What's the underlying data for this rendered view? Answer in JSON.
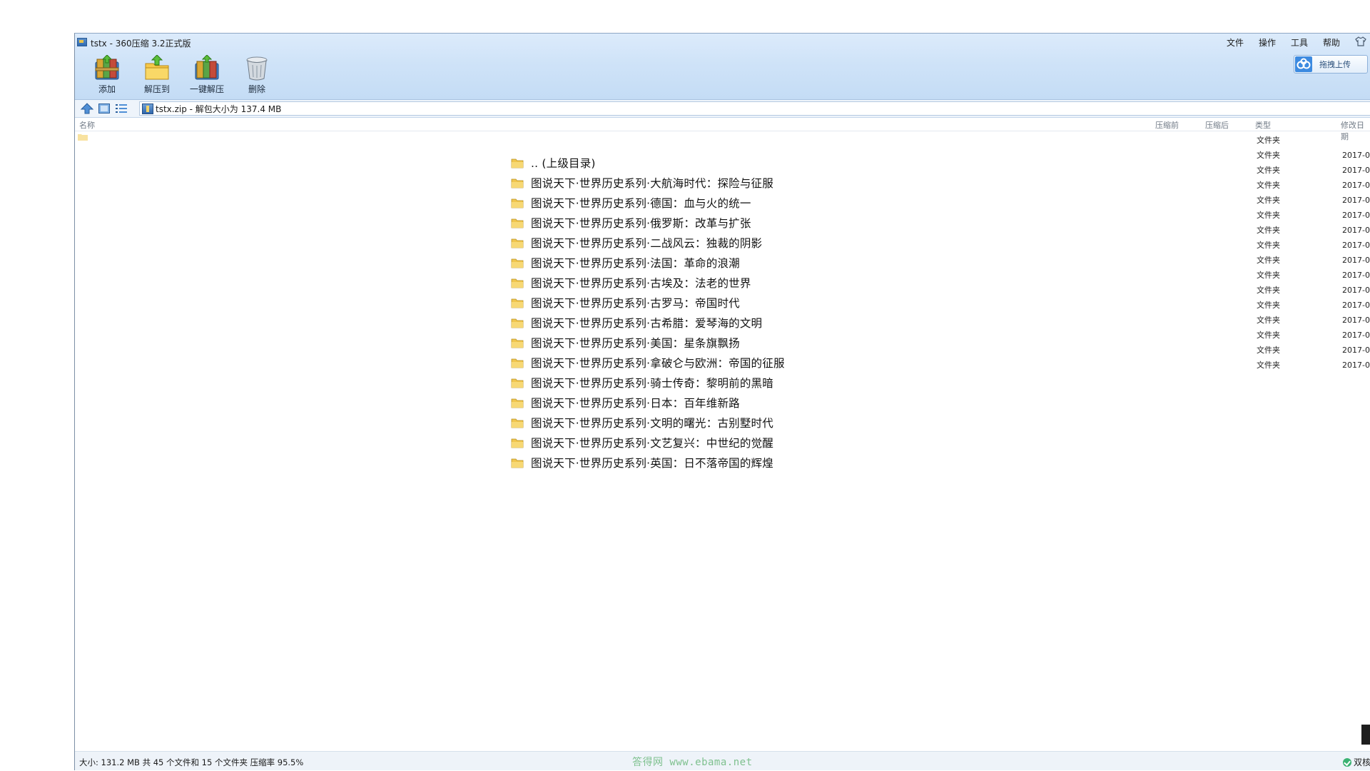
{
  "window": {
    "title": "tstx - 360压缩 3.2正式版",
    "menu": [
      "文件",
      "操作",
      "工具",
      "帮助"
    ],
    "shirt_icon": "shirt-icon"
  },
  "toolbar": [
    {
      "label": "添加",
      "icon": "add-archive-icon"
    },
    {
      "label": "解压到",
      "icon": "extract-to-icon"
    },
    {
      "label": "一键解压",
      "icon": "one-click-extract-icon"
    },
    {
      "label": "删除",
      "icon": "trash-icon"
    }
  ],
  "cloud_upload": {
    "label": "拖拽上传",
    "icon": "cloud-icon"
  },
  "address": {
    "path": "tstx.zip - 解包大小为 137.4 MB"
  },
  "columns": {
    "name": "名称",
    "before": "压缩前",
    "after": "压缩后",
    "type": "类型",
    "date": "修改日期"
  },
  "rows": [
    {
      "type": "文件夹",
      "date": ""
    },
    {
      "type": "文件夹",
      "date": "2017-0"
    },
    {
      "type": "文件夹",
      "date": "2017-0"
    },
    {
      "type": "文件夹",
      "date": "2017-0"
    },
    {
      "type": "文件夹",
      "date": "2017-0"
    },
    {
      "type": "文件夹",
      "date": "2017-0"
    },
    {
      "type": "文件夹",
      "date": "2017-0"
    },
    {
      "type": "文件夹",
      "date": "2017-0"
    },
    {
      "type": "文件夹",
      "date": "2017-0"
    },
    {
      "type": "文件夹",
      "date": "2017-0"
    },
    {
      "type": "文件夹",
      "date": "2017-0"
    },
    {
      "type": "文件夹",
      "date": "2017-0"
    },
    {
      "type": "文件夹",
      "date": "2017-0"
    },
    {
      "type": "文件夹",
      "date": "2017-0"
    },
    {
      "type": "文件夹",
      "date": "2017-0"
    },
    {
      "type": "文件夹",
      "date": "2017-0"
    }
  ],
  "folders": [
    ".. (上级目录)",
    "图说天下·世界历史系列·大航海时代：探险与征服",
    "图说天下·世界历史系列·德国：血与火的统一",
    "图说天下·世界历史系列·俄罗斯：改革与扩张",
    "图说天下·世界历史系列·二战风云：独裁的阴影",
    "图说天下·世界历史系列·法国：革命的浪潮",
    "图说天下·世界历史系列·古埃及：法老的世界",
    "图说天下·世界历史系列·古罗马：帝国时代",
    "图说天下·世界历史系列·古希腊：爱琴海的文明",
    "图说天下·世界历史系列·美国：星条旗飘扬",
    "图说天下·世界历史系列·拿破仑与欧洲：帝国的征服",
    "图说天下·世界历史系列·骑士传奇：黎明前的黑暗",
    "图说天下·世界历史系列·日本：百年维新路",
    "图说天下·世界历史系列·文明的曙光：古别墅时代",
    "图说天下·世界历史系列·文艺复兴：中世纪的觉醒",
    "图说天下·世界历史系列·英国：日不落帝国的辉煌"
  ],
  "status": {
    "summary": "大小: 131.2 MB 共 45 个文件和 15 个文件夹 压缩率 95.5%",
    "dual_label": "双核"
  },
  "watermark": "答得网 www.ebama.net"
}
